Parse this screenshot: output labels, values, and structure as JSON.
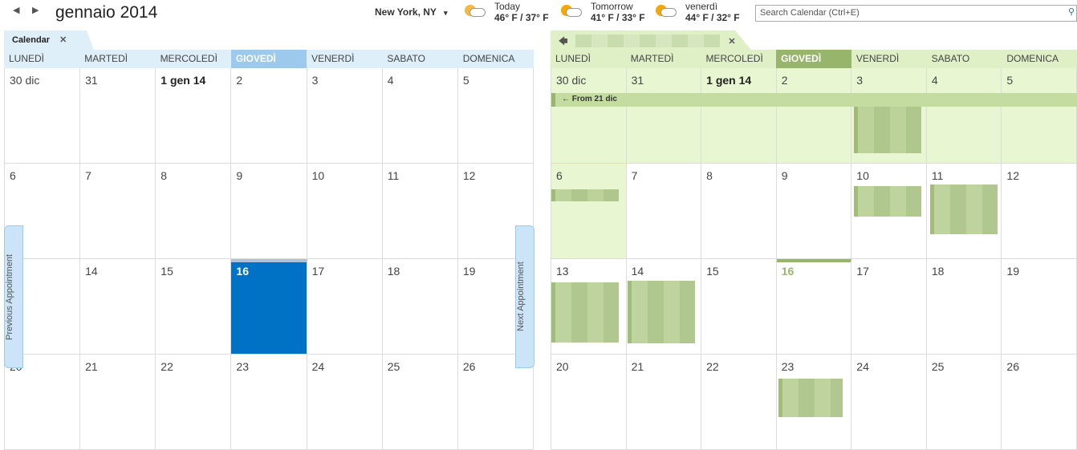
{
  "header": {
    "prev_icon": "triangle-left-icon",
    "next_icon": "triangle-right-icon",
    "title": "gennaio 2014",
    "location": "New York, NY",
    "location_dropdown_icon": "caret-down-icon"
  },
  "weather": [
    {
      "label": "Today",
      "temps": "46° F / 37° F",
      "icon": "moon-cloud-icon"
    },
    {
      "label": "Tomorrow",
      "temps": "41° F / 33° F",
      "icon": "sun-cloud-icon"
    },
    {
      "label": "venerdì",
      "temps": "44° F / 32° F",
      "icon": "sun-cloud-icon"
    }
  ],
  "search": {
    "placeholder": "Search Calendar (Ctrl+E)",
    "icon": "search-icon"
  },
  "left_calendar": {
    "tab_label": "Calendar",
    "accent": "#0072c6",
    "header_bg": "#dfeffa",
    "today_header_bg": "#9cc9ec"
  },
  "right_calendar": {
    "tab_label": "",
    "accent": "#98b56c",
    "header_bg": "#e0f0c6",
    "today_header_bg": "#98b56c",
    "banner": "From 21 dic"
  },
  "days": [
    "LUNEDÌ",
    "MARTEDÌ",
    "MERCOLEDÌ",
    "GIOVEDÌ",
    "VENERDÌ",
    "SABATO",
    "DOMENICA"
  ],
  "today_index": 3,
  "weeks": [
    [
      "30 dic",
      "31",
      "1 gen 14",
      "2",
      "3",
      "4",
      "5"
    ],
    [
      "6",
      "7",
      "8",
      "9",
      "10",
      "11",
      "12"
    ],
    [
      "13",
      "14",
      "15",
      "16",
      "17",
      "18",
      "19"
    ],
    [
      "20",
      "21",
      "22",
      "23",
      "24",
      "25",
      "26"
    ]
  ],
  "side_buttons": {
    "previous": "Previous Appointment",
    "next": "Next Appointment"
  }
}
